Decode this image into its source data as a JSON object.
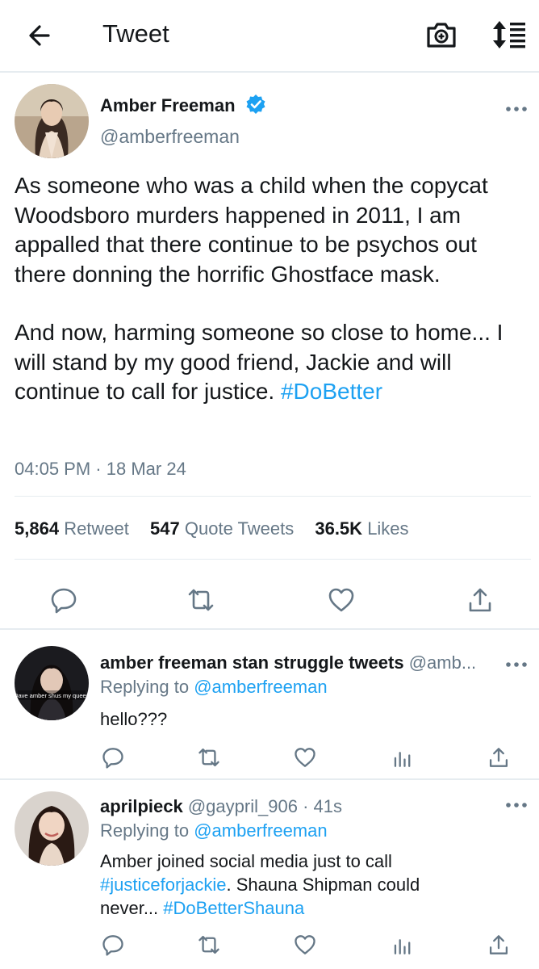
{
  "header": {
    "title": "Tweet",
    "back_icon": "back-arrow-icon",
    "camera_icon": "camera-icon",
    "sort_icon": "sort-icon"
  },
  "tweet": {
    "author_name": "Amber Freeman",
    "verified": true,
    "handle": "@amberfreeman",
    "paragraph1": "As someone who was a child when the copycat Woodsboro murders happened in 2011, I am appalled that there continue to be psychos out there donning the horrific Ghostface mask.",
    "paragraph2_text": "And now, harming someone so close to home... I will stand by my good friend, Jackie and will continue to call for justice.",
    "paragraph2_hashtag": "#DoBetter",
    "time": "04:05 PM",
    "date_sep": "·",
    "date": "18 Mar 24",
    "retweets_count": "5,864",
    "retweets_label": "Retweet",
    "quotes_count": "547",
    "quotes_label": "Quote Tweets",
    "likes_count": "36.5K",
    "likes_label": "Likes"
  },
  "replies": [
    {
      "name": "amber freeman stan struggle tweets",
      "handle": "@amb...",
      "avatar_text": "Dave amber shus my queen",
      "replying_label": "Replying to",
      "replying_to": "@amberfreeman",
      "text": "hello???"
    },
    {
      "name": "aprilpieck",
      "handle": "@gaypril_906",
      "sep": "·",
      "time": "41s",
      "replying_label": "Replying to",
      "replying_to": "@amberfreeman",
      "text_line1": "Amber joined social media just to call",
      "hashtag1": "#justiceforjackie",
      "text_line2": ". Shauna Shipman could",
      "text_line3": "never...",
      "hashtag2": "#DoBetterShauna"
    }
  ],
  "colors": {
    "accent": "#1da1f2",
    "muted": "#657786",
    "text": "#14171a",
    "divider": "#e6ecf0"
  }
}
